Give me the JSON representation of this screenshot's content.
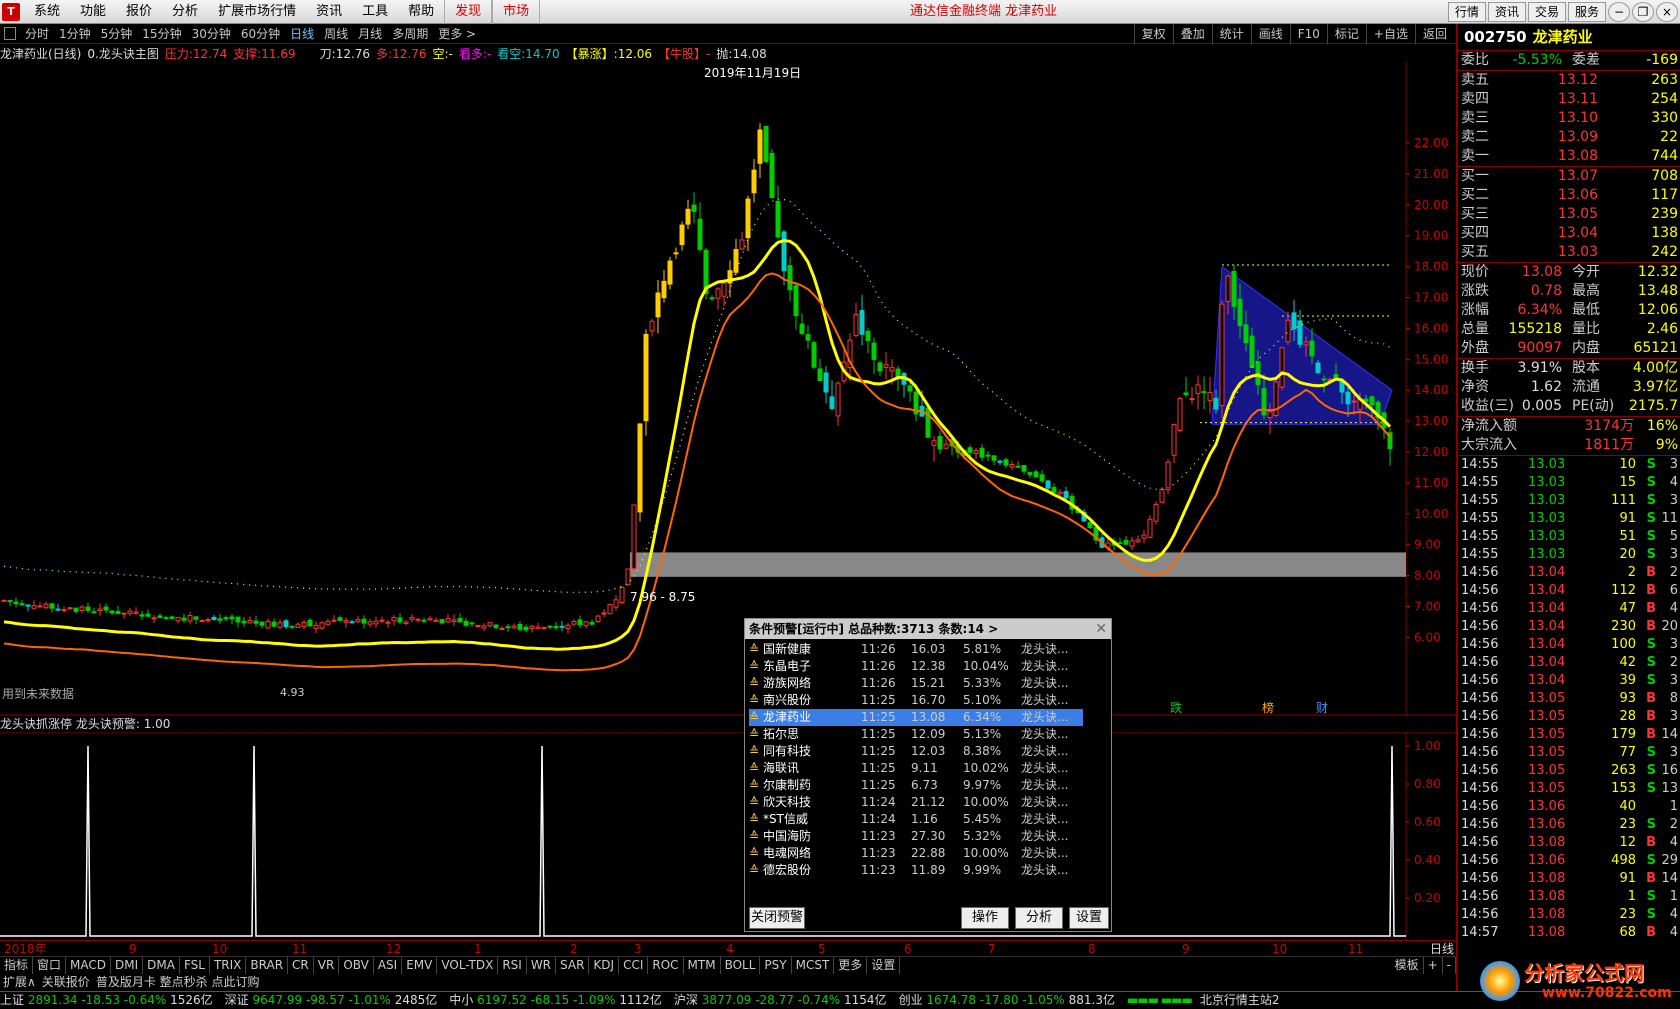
{
  "menubar": {
    "items": [
      "系统",
      "功能",
      "报价",
      "分析",
      "扩展市场行情",
      "资讯",
      "工具",
      "帮助"
    ],
    "red_items": [
      "发现",
      "市场"
    ],
    "title": "通达信金融终端 龙津药业",
    "right_buttons": [
      "行情",
      "资讯",
      "交易",
      "服务"
    ]
  },
  "periodbar": {
    "periods": [
      "分时",
      "1分钟",
      "5分钟",
      "15分钟",
      "30分钟",
      "60分钟",
      "日线",
      "周线",
      "月线",
      "多周期",
      "更多 >"
    ],
    "active": "日线",
    "tools": [
      "复权",
      "叠加",
      "统计",
      "画线",
      "F10",
      "标记",
      "+自选",
      "返回"
    ]
  },
  "indicator_header": {
    "title": "龙津药业(日线)",
    "formula": "0.龙头诀主图",
    "pressure_label": "压力:",
    "pressure": "12.74",
    "support_label": "支撑:",
    "support": "11.69",
    "blade_label": "刀:",
    "blade": "12.76",
    "long_label": "多:",
    "long": "12.76",
    "short_label": "空:",
    "short": "-",
    "bull_label": "看多:",
    "bull": "-",
    "bear_label": "看空:",
    "bear": "14.70",
    "surge_label": "【暴涨】:",
    "surge": "12.06",
    "cow_label": "【牛股】",
    "cow": "-",
    "throw_label": "抛:",
    "throw": "14.08"
  },
  "main_chart": {
    "date_label": "2019年11月19日",
    "band_label": "7.96 - 8.75",
    "low_label": "4.93",
    "future_data_label": "用到未来数据",
    "markers": [
      "跌",
      "榜",
      "财"
    ],
    "y_ticks": [
      "22.00",
      "21.00",
      "20.00",
      "19.00",
      "18.00",
      "17.00",
      "16.00",
      "15.00",
      "14.00",
      "13.00",
      "12.00",
      "11.00",
      "10.00",
      "9.00",
      "8.00",
      "7.00",
      "6.00"
    ]
  },
  "sub_chart": {
    "title": "龙头诀抓涨停",
    "value_label": "龙头诀预警:",
    "value": "1.00",
    "y_ticks": [
      "1.00",
      "0.80",
      "0.60",
      "0.40",
      "0.20"
    ]
  },
  "date_axis": {
    "labels": [
      "2018年",
      "9",
      "10",
      "11",
      "12",
      "1",
      "2",
      "3",
      "4",
      "5",
      "6",
      "7",
      "8",
      "9",
      "10",
      "11"
    ],
    "cycle": "日线"
  },
  "indicator_tabs": [
    "指标",
    "窗口",
    "MACD",
    "DMI",
    "DMA",
    "FSL",
    "TRIX",
    "BRAR",
    "CR",
    "VR",
    "OBV",
    "ASI",
    "EMV",
    "VOL-TDX",
    "RSI",
    "WR",
    "SAR",
    "KDJ",
    "CCI",
    "ROC",
    "MTM",
    "BOLL",
    "PSY",
    "MCST",
    "更多",
    "设置"
  ],
  "indicator_tabs_right": [
    "模板",
    "+",
    "-"
  ],
  "link_tabs": [
    "扩展∧",
    "关联报价",
    "普及版月卡 整点秒杀 点此订购"
  ],
  "status": {
    "indices": [
      {
        "name": "上证",
        "value": "2891.34",
        "chg": "-18.53",
        "pct": "-0.64%",
        "amt": "1526亿"
      },
      {
        "name": "深证",
        "value": "9647.99",
        "chg": "-98.57",
        "pct": "-1.01%",
        "amt": "2485亿"
      },
      {
        "name": "中小",
        "value": "6197.52",
        "chg": "-68.15",
        "pct": "-1.09%",
        "amt": "1112亿"
      },
      {
        "name": "沪深",
        "value": "3877.09",
        "chg": "-28.77",
        "pct": "-0.74%",
        "amt": "1154亿"
      },
      {
        "name": "创业",
        "value": "1674.78",
        "chg": "-17.80",
        "pct": "-1.05%",
        "amt": "881.3亿"
      }
    ],
    "server": "北京行情主站2"
  },
  "quote": {
    "code": "002750",
    "name": "龙津药业",
    "weibi_label": "委比",
    "weibi": "-5.53%",
    "weicha_label": "委差",
    "weicha": "-169",
    "asks": [
      {
        "label": "卖五",
        "price": "13.12",
        "vol": "263"
      },
      {
        "label": "卖四",
        "price": "13.11",
        "vol": "254"
      },
      {
        "label": "卖三",
        "price": "13.10",
        "vol": "330"
      },
      {
        "label": "卖二",
        "price": "13.09",
        "vol": "22"
      },
      {
        "label": "卖一",
        "price": "13.08",
        "vol": "744"
      }
    ],
    "bids": [
      {
        "label": "买一",
        "price": "13.07",
        "vol": "708"
      },
      {
        "label": "买二",
        "price": "13.06",
        "vol": "117"
      },
      {
        "label": "买三",
        "price": "13.05",
        "vol": "239"
      },
      {
        "label": "买四",
        "price": "13.04",
        "vol": "138"
      },
      {
        "label": "买五",
        "price": "13.03",
        "vol": "242"
      }
    ],
    "stats": [
      {
        "l1": "现价",
        "v1": "13.08",
        "c1": "red",
        "l2": "今开",
        "v2": "12.32",
        "c2": "red"
      },
      {
        "l1": "涨跌",
        "v1": "0.78",
        "c1": "red",
        "l2": "最高",
        "v2": "13.48",
        "c2": "red"
      },
      {
        "l1": "涨幅",
        "v1": "6.34%",
        "c1": "red",
        "l2": "最低",
        "v2": "12.06",
        "c2": "grn"
      },
      {
        "l1": "总量",
        "v1": "155218",
        "c1": "yel",
        "l2": "量比",
        "v2": "2.46",
        "c2": "red"
      },
      {
        "l1": "外盘",
        "v1": "90097",
        "c1": "red",
        "l2": "内盘",
        "v2": "65121",
        "c2": "grn"
      }
    ],
    "stats2": [
      {
        "l1": "换手",
        "v1": "3.91%",
        "c1": "wht",
        "l2": "股本",
        "v2": "4.00亿",
        "c2": "wht"
      },
      {
        "l1": "净资",
        "v1": "1.62",
        "c1": "wht",
        "l2": "流通",
        "v2": "3.97亿",
        "c2": "wht"
      },
      {
        "l1": "收益(三)",
        "v1": "0.005",
        "c1": "wht",
        "l2": "PE(动)",
        "v2": "2175.7",
        "c2": "wht"
      }
    ],
    "flows": [
      {
        "label": "净流入额",
        "value": "3174万",
        "pct": "16%"
      },
      {
        "label": "大宗流入",
        "value": "1811万",
        "pct": "9%"
      }
    ],
    "ticks": [
      {
        "t": "14:55",
        "p": "13.03",
        "q": "10",
        "d": "S",
        "c": "3"
      },
      {
        "t": "14:55",
        "p": "13.03",
        "q": "15",
        "d": "S",
        "c": "4"
      },
      {
        "t": "14:55",
        "p": "13.03",
        "q": "111",
        "d": "S",
        "c": "3"
      },
      {
        "t": "14:55",
        "p": "13.03",
        "q": "91",
        "d": "S",
        "c": "11"
      },
      {
        "t": "14:55",
        "p": "13.03",
        "q": "51",
        "d": "S",
        "c": "5"
      },
      {
        "t": "14:55",
        "p": "13.03",
        "q": "20",
        "d": "S",
        "c": "3"
      },
      {
        "t": "14:56",
        "p": "13.04",
        "q": "2",
        "d": "B",
        "c": "2"
      },
      {
        "t": "14:56",
        "p": "13.04",
        "q": "112",
        "d": "B",
        "c": "6"
      },
      {
        "t": "14:56",
        "p": "13.04",
        "q": "47",
        "d": "B",
        "c": "4"
      },
      {
        "t": "14:56",
        "p": "13.04",
        "q": "230",
        "d": "B",
        "c": "20"
      },
      {
        "t": "14:56",
        "p": "13.04",
        "q": "100",
        "d": "S",
        "c": "3"
      },
      {
        "t": "14:56",
        "p": "13.04",
        "q": "42",
        "d": "S",
        "c": "2"
      },
      {
        "t": "14:56",
        "p": "13.04",
        "q": "39",
        "d": "S",
        "c": "3"
      },
      {
        "t": "14:56",
        "p": "13.05",
        "q": "93",
        "d": "B",
        "c": "8"
      },
      {
        "t": "14:56",
        "p": "13.05",
        "q": "28",
        "d": "B",
        "c": "3"
      },
      {
        "t": "14:56",
        "p": "13.05",
        "q": "179",
        "d": "B",
        "c": "14"
      },
      {
        "t": "14:56",
        "p": "13.05",
        "q": "77",
        "d": "S",
        "c": "3"
      },
      {
        "t": "14:56",
        "p": "13.05",
        "q": "263",
        "d": "S",
        "c": "16"
      },
      {
        "t": "14:56",
        "p": "13.05",
        "q": "153",
        "d": "S",
        "c": "13"
      },
      {
        "t": "14:56",
        "p": "13.06",
        "q": "40",
        "d": "",
        "c": "1"
      },
      {
        "t": "14:56",
        "p": "13.06",
        "q": "23",
        "d": "S",
        "c": "2"
      },
      {
        "t": "14:56",
        "p": "13.08",
        "q": "12",
        "d": "B",
        "c": "4"
      },
      {
        "t": "14:56",
        "p": "13.06",
        "q": "498",
        "d": "S",
        "c": "29"
      },
      {
        "t": "14:56",
        "p": "13.08",
        "q": "91",
        "d": "B",
        "c": "14"
      },
      {
        "t": "14:56",
        "p": "13.08",
        "q": "1",
        "d": "S",
        "c": "1"
      },
      {
        "t": "14:56",
        "p": "13.08",
        "q": "23",
        "d": "S",
        "c": "4"
      },
      {
        "t": "14:57",
        "p": "13.08",
        "q": "68",
        "d": "B",
        "c": "4"
      }
    ]
  },
  "popup": {
    "title": "条件预警[运行中] 总品种数:3713 条数:14  >",
    "selected_index": 4,
    "rows": [
      {
        "name": "国新健康",
        "time": "11:26",
        "price": "16.03",
        "pct": "5.81%",
        "cond": "龙头诀..."
      },
      {
        "name": "东晶电子",
        "time": "11:26",
        "price": "12.38",
        "pct": "10.04%",
        "cond": "龙头诀..."
      },
      {
        "name": "游族网络",
        "time": "11:26",
        "price": "15.21",
        "pct": "5.33%",
        "cond": "龙头诀..."
      },
      {
        "name": "南兴股份",
        "time": "11:25",
        "price": "16.70",
        "pct": "5.10%",
        "cond": "龙头诀..."
      },
      {
        "name": "龙津药业",
        "time": "11:25",
        "price": "13.08",
        "pct": "6.34%",
        "cond": "龙头诀..."
      },
      {
        "name": "拓尔思",
        "time": "11:25",
        "price": "12.09",
        "pct": "5.13%",
        "cond": "龙头诀..."
      },
      {
        "name": "同有科技",
        "time": "11:25",
        "price": "12.03",
        "pct": "8.38%",
        "cond": "龙头诀..."
      },
      {
        "name": "海联讯",
        "time": "11:25",
        "price": "9.11",
        "pct": "10.02%",
        "cond": "龙头诀..."
      },
      {
        "name": "尔康制药",
        "time": "11:25",
        "price": "6.73",
        "pct": "9.97%",
        "cond": "龙头诀..."
      },
      {
        "name": "欣天科技",
        "time": "11:24",
        "price": "21.12",
        "pct": "10.00%",
        "cond": "龙头诀..."
      },
      {
        "name": "*ST信威",
        "time": "11:24",
        "price": "1.16",
        "pct": "5.45%",
        "cond": "龙头诀..."
      },
      {
        "name": "中国海防",
        "time": "11:23",
        "price": "27.30",
        "pct": "5.32%",
        "cond": "龙头诀..."
      },
      {
        "name": "电魂网络",
        "time": "11:23",
        "price": "22.88",
        "pct": "10.00%",
        "cond": "龙头诀..."
      },
      {
        "name": "德宏股份",
        "time": "11:23",
        "price": "11.89",
        "pct": "9.99%",
        "cond": "龙头诀..."
      }
    ],
    "buttons": {
      "close": "关闭预警",
      "operate": "操作",
      "analyze": "分析",
      "settings": "设置"
    }
  },
  "watermark": {
    "text": "分析家公式网",
    "url": "www.70822.com"
  },
  "colors": {
    "up": "#ff3333",
    "down": "#00cc00",
    "accent": "#ffff00",
    "border": "#880000"
  }
}
